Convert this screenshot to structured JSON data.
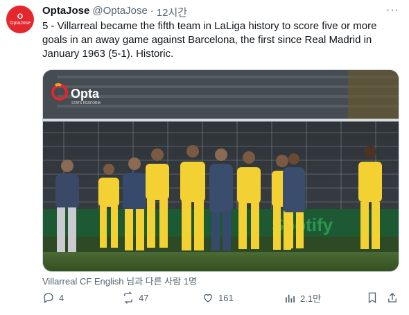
{
  "author": {
    "display_name": "OptaJose",
    "handle": "@OptaJose",
    "separator": "·",
    "time": "12시간",
    "avatar_mark": "O",
    "avatar_brand": "OptaJose"
  },
  "more_label": "···",
  "tweet": {
    "text": "5 - Villarreal became the fifth team in LaLiga history to score five or more goals in an away game against Barcelona, the first since Real Madrid in January 1963 (5-1). Historic."
  },
  "media": {
    "logo_text": "Opta",
    "logo_sub": "STATS PERFORM",
    "ad_board_text": "Spotify"
  },
  "tagline": "Villarreal CF English 님과 다른 사람 1명",
  "actions": {
    "reply_count": "4",
    "retweet_count": "47",
    "like_count": "161",
    "view_count": "2.1만"
  },
  "colors": {
    "accent": "#e4262d",
    "muted": "#536471",
    "kit_yellow": "#f3d132",
    "pitch": "#3f5b2d"
  }
}
